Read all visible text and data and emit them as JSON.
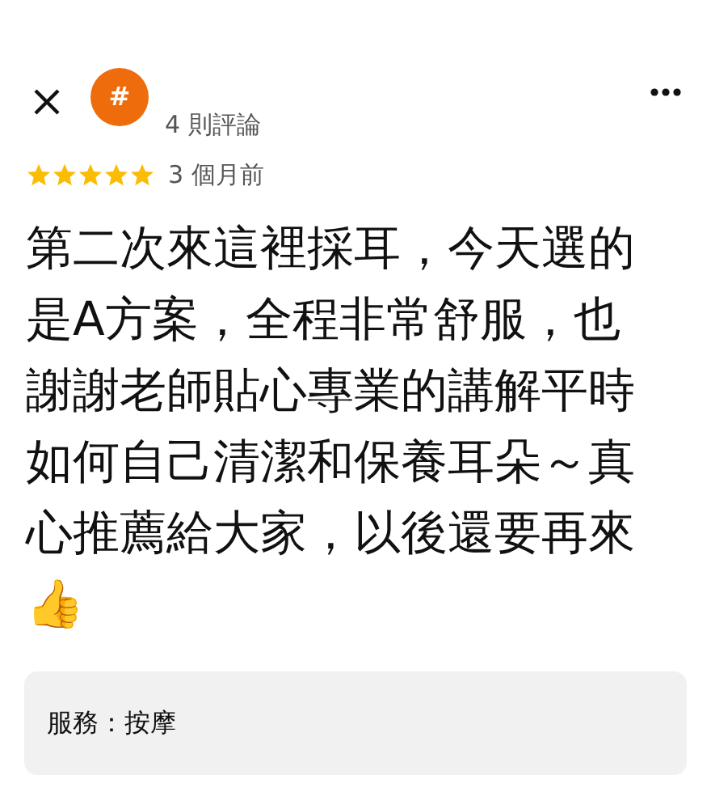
{
  "header": {
    "avatar_letter": "#",
    "review_count": "4 則評論"
  },
  "rating": {
    "stars": 5,
    "time": "3 個月前"
  },
  "review_text": "第二次來這裡採耳，今天選的是A方案，全程非常舒服，也謝謝老師貼心專業的講解平時如何自己清潔和保養耳朵～真心推薦給大家，以後還要再來👍",
  "service": "服務：按摩"
}
